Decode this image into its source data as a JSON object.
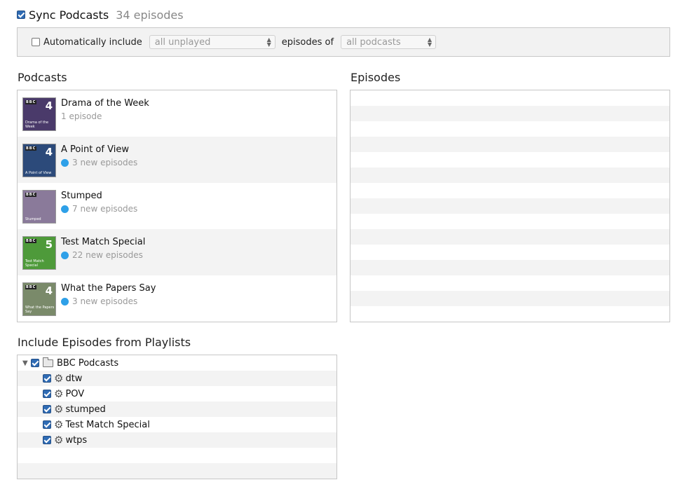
{
  "header": {
    "title": "Sync Podcasts",
    "count": "34 episodes",
    "sync_checked": true
  },
  "options": {
    "auto_include_label": "Automatically include",
    "auto_include_checked": false,
    "unplayed_value": "all unplayed",
    "episodes_of_label": "episodes of",
    "podcasts_value": "all podcasts"
  },
  "podcasts": {
    "title": "Podcasts",
    "items": [
      {
        "name": "Drama of the Week",
        "sub": "1 episode",
        "new": false,
        "art_text": "4",
        "art_bg": "#4a3a6a",
        "art_caption": "Drama of the Week"
      },
      {
        "name": "A Point of View",
        "sub": "3 new episodes",
        "new": true,
        "art_text": "4",
        "art_bg": "#2c4a7a",
        "art_caption": "A Point of View"
      },
      {
        "name": "Stumped",
        "sub": "7 new episodes",
        "new": true,
        "art_text": "",
        "art_bg": "#8a7a9a",
        "art_caption": "Stumped"
      },
      {
        "name": "Test Match Special",
        "sub": "22 new episodes",
        "new": true,
        "art_text": "5",
        "art_bg": "#4e9a3a",
        "art_caption": "Test Match Special"
      },
      {
        "name": "What the Papers Say",
        "sub": "3 new episodes",
        "new": true,
        "art_text": "4",
        "art_bg": "#7a8a6a",
        "art_caption": "What the Papers Say"
      }
    ]
  },
  "episodes": {
    "title": "Episodes"
  },
  "playlists": {
    "title": "Include Episodes from Playlists",
    "folder": {
      "label": "BBC Podcasts",
      "checked": true
    },
    "items": [
      {
        "label": "dtw",
        "checked": true
      },
      {
        "label": "POV",
        "checked": true
      },
      {
        "label": "stumped",
        "checked": true
      },
      {
        "label": "Test Match Special",
        "checked": true
      },
      {
        "label": "wtps",
        "checked": true
      }
    ]
  },
  "colors": {
    "new_dot": "#2ea0e8",
    "checkbox_blue": "#2f6cb5",
    "stripe": "#f3f3f3"
  }
}
